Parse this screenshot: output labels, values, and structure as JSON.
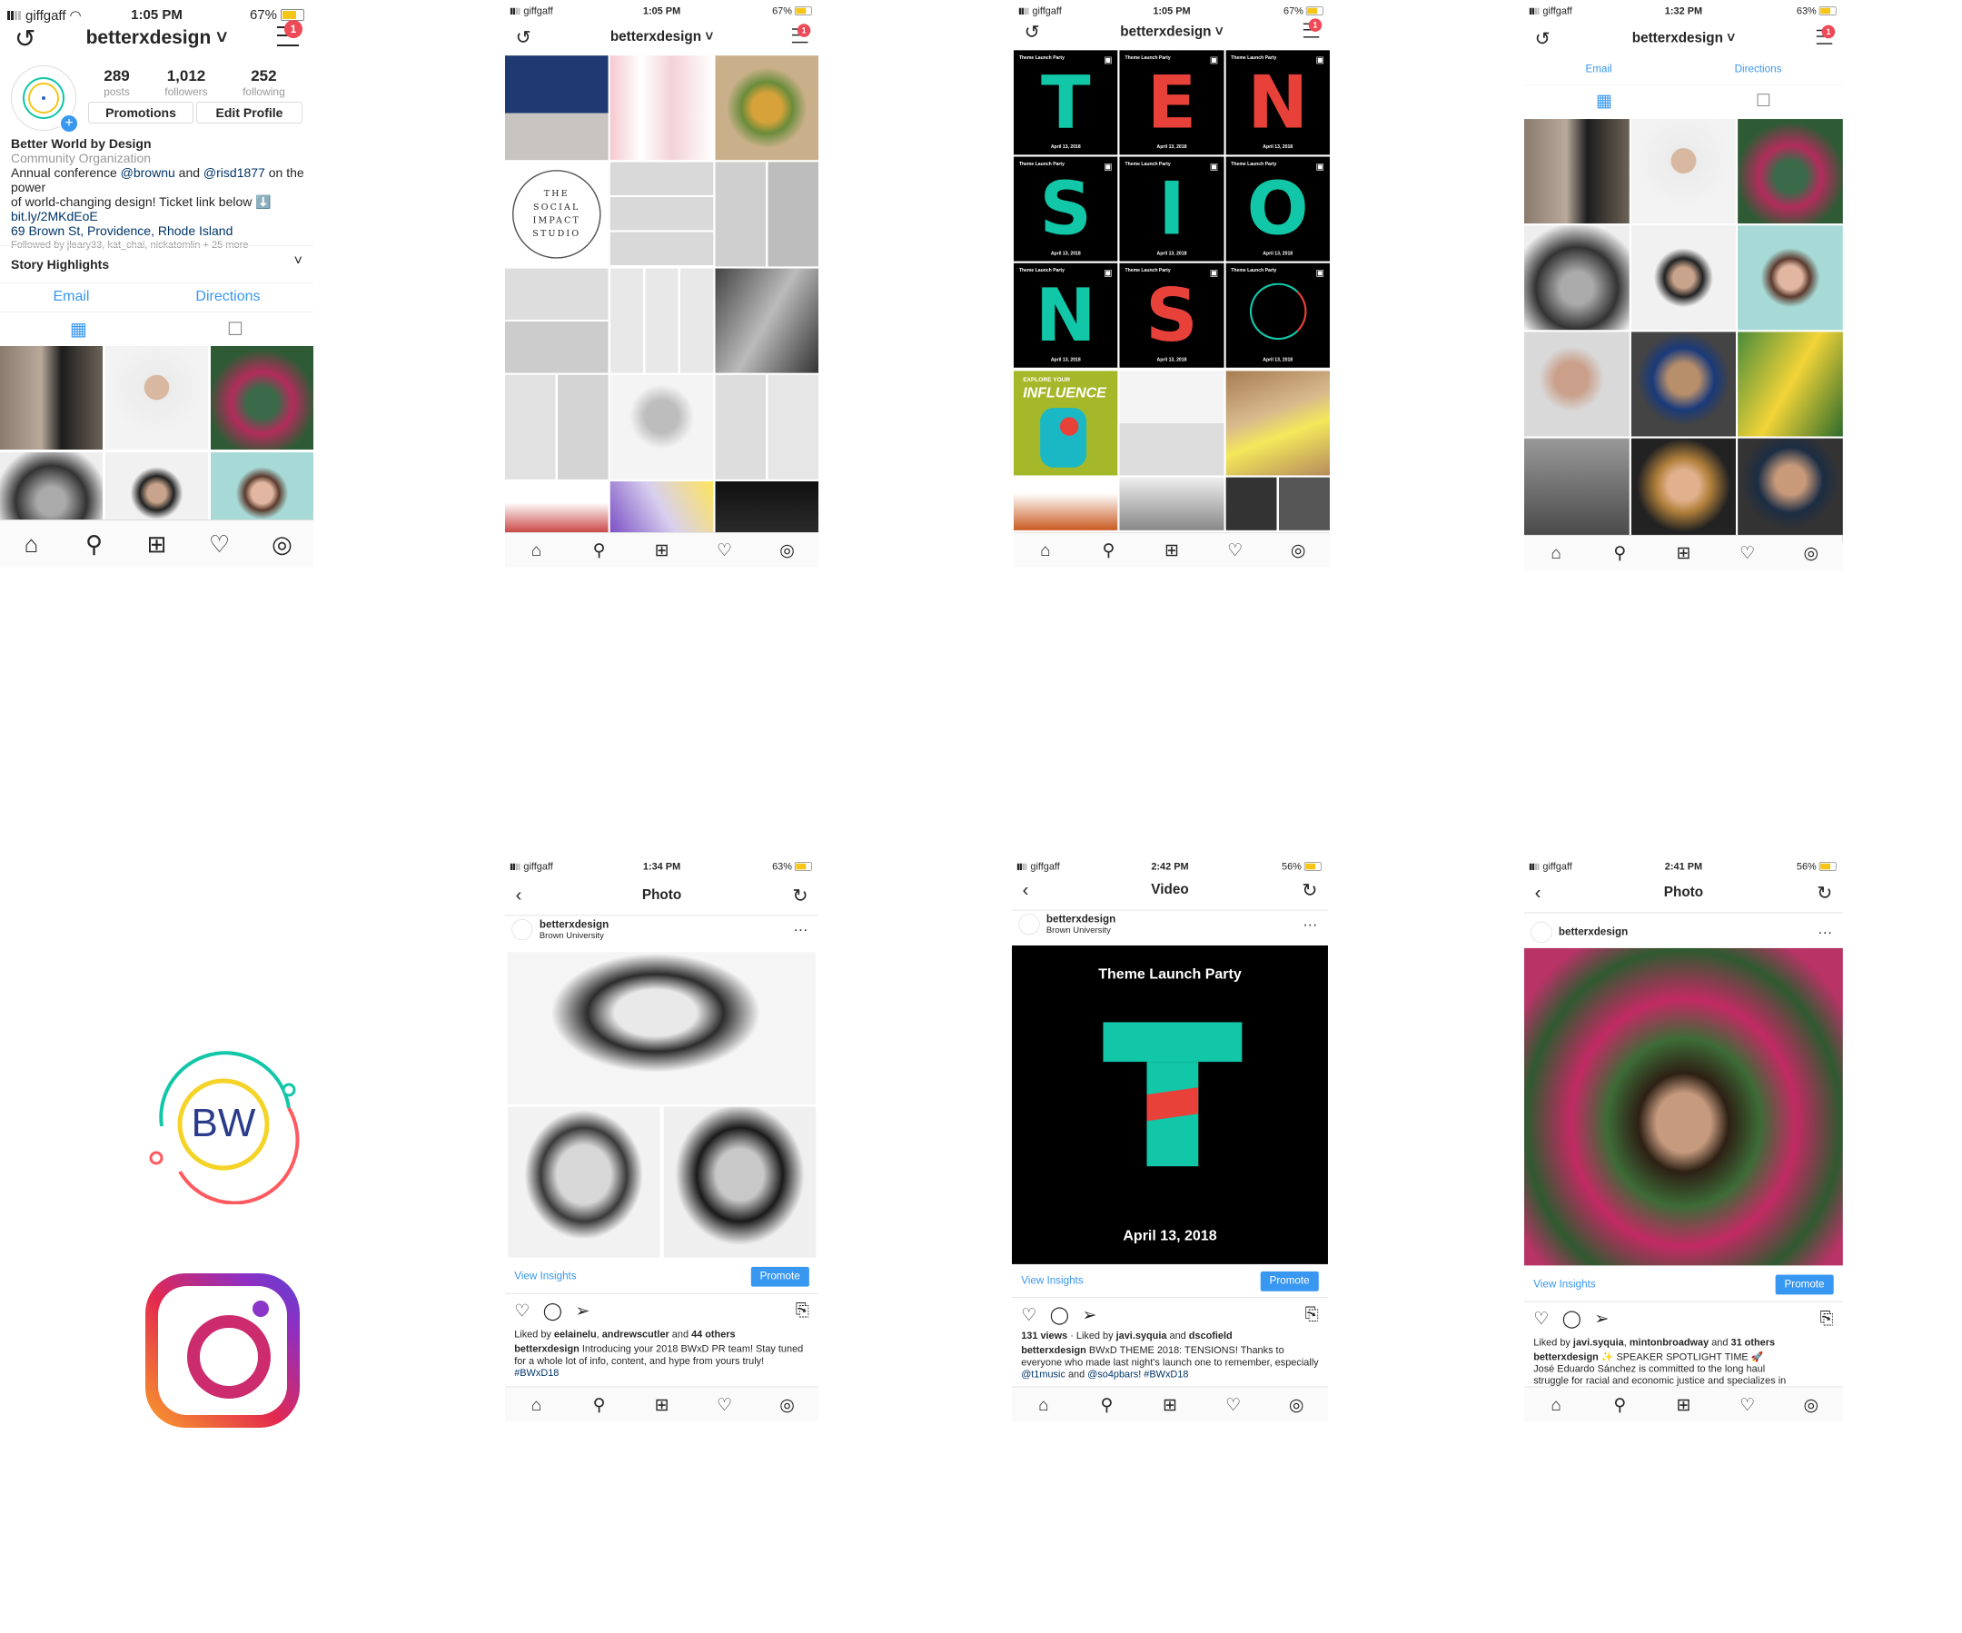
{
  "status": {
    "carrier": "giffgaff"
  },
  "p1": {
    "time": "1:05 PM",
    "battery": "67%",
    "username": "betterxdesign",
    "badge": "1",
    "posts": {
      "n": "289",
      "l": "posts"
    },
    "followers": {
      "n": "1,012",
      "l": "followers"
    },
    "following": {
      "n": "252",
      "l": "following"
    },
    "btn_promo": "Promotions",
    "btn_edit": "Edit Profile",
    "name": "Better World by Design",
    "category": "Community Organization",
    "bio1_a": "Annual conference ",
    "bio1_b": "@brownu",
    "bio1_c": " and ",
    "bio1_d": "@risd1877",
    "bio1_e": " on the power",
    "bio2": "of world-changing design! Ticket link below ⬇️",
    "link": "bit.ly/2MKdEoE",
    "address": "69 Brown St, Providence, Rhode Island",
    "followed": "Followed by jleary33, kat_chai, nickatomlin + 25 more",
    "highlights": "Story Highlights",
    "email": "Email",
    "directions": "Directions"
  },
  "p2": {
    "time": "1:05 PM",
    "battery": "67%",
    "username": "betterxdesign",
    "badge": "1",
    "studio": [
      "THE",
      "SOCIAL",
      "IMPACT",
      "STUDIO"
    ]
  },
  "p3": {
    "time": "1:05 PM",
    "battery": "67%",
    "username": "betterxdesign",
    "badge": "1",
    "card_title": "Theme Launch Party",
    "card_date": "April 13, 2018",
    "letters": [
      "T",
      "E",
      "N",
      "S",
      "I",
      "O",
      "N",
      "S",
      ""
    ],
    "explore": "EXPLORE YOUR",
    "influence": "INFLUENCE"
  },
  "p4": {
    "time": "1:32 PM",
    "battery": "63%",
    "username": "betterxdesign",
    "badge": "1",
    "email": "Email",
    "directions": "Directions"
  },
  "logo": {
    "bw": "BW"
  },
  "p6": {
    "time": "1:34 PM",
    "battery": "63%",
    "title": "Photo",
    "username": "betterxdesign",
    "location": "Brown University",
    "view_insights": "View Insights",
    "promote": "Promote",
    "liked_a": "Liked by ",
    "liked_b": "eelainelu",
    "liked_c": ", ",
    "liked_d": "andrewscutler",
    "liked_e": " and ",
    "liked_f": "44 others",
    "cap_user": "betterxdesign",
    "cap_text": " Introducing your 2018 BWxD PR team! Stay tuned for a whole lot of info, content, and hype from yours truly! ",
    "cap_tag": "#BWxD18"
  },
  "p7": {
    "time": "2:42 PM",
    "battery": "56%",
    "title": "Video",
    "username": "betterxdesign",
    "location": "Brown University",
    "video_title": "Theme Launch Party",
    "video_date": "April 13, 2018",
    "letter": "T",
    "view_insights": "View Insights",
    "promote": "Promote",
    "views": "131 views",
    "liked_a": " · Liked by ",
    "liked_b": "javi.syquia",
    "liked_c": " and ",
    "liked_d": "dscofield",
    "cap_user": "betterxdesign",
    "cap_text": " BWxD THEME 2018: TENSIONS! Thanks to everyone who made last night's launch one to remember, especially ",
    "cap_m1": "@t1music",
    "cap_and": " and ",
    "cap_m2": "@so4pbars",
    "cap_sp": "! ",
    "cap_tag": "#BWxD18"
  },
  "p8": {
    "time": "2:41 PM",
    "battery": "56%",
    "title": "Photo",
    "username": "betterxdesign",
    "view_insights": "View Insights",
    "promote": "Promote",
    "liked_a": "Liked by ",
    "liked_b": "javi.syquia",
    "liked_c": ", ",
    "liked_d": "mintonbroadway",
    "liked_e": " and ",
    "liked_f": "31 others",
    "cap_user": "betterxdesign",
    "cap_text": " ✨ SPEAKER SPOTLIGHT TIME 🚀",
    "cap_line2": "José Eduardo Sánchez is committed to the long haul",
    "cap_line3": "struggle for racial and economic justice and specializes in"
  },
  "icons": {
    "home": "home-icon",
    "search": "search-icon",
    "add": "add-icon",
    "heart": "heart-icon",
    "profile": "profile-icon"
  }
}
